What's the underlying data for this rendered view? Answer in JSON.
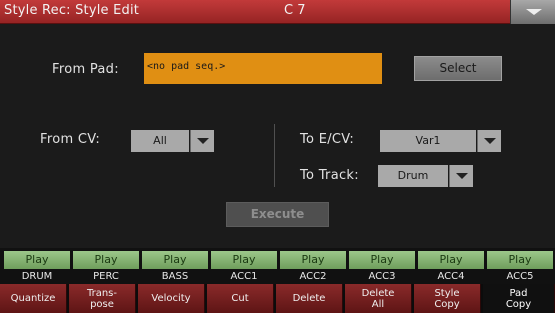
{
  "title": {
    "text": "Style Rec: Style Edit",
    "chord": "C 7",
    "menu_icon": "chevron-down-icon"
  },
  "from_pad": {
    "label": "From Pad:",
    "value": "<no pad seq.>",
    "select_label": "Select"
  },
  "from_cv": {
    "label": "From CV:",
    "value": "All"
  },
  "to_ecv": {
    "label": "To E/CV:",
    "value": "Var1"
  },
  "to_track": {
    "label": "To Track:",
    "value": "Drum"
  },
  "execute_label": "Execute",
  "tracks": [
    {
      "play": "Play",
      "name": "DRUM"
    },
    {
      "play": "Play",
      "name": "PERC"
    },
    {
      "play": "Play",
      "name": "BASS"
    },
    {
      "play": "Play",
      "name": "ACC1"
    },
    {
      "play": "Play",
      "name": "ACC2"
    },
    {
      "play": "Play",
      "name": "ACC3"
    },
    {
      "play": "Play",
      "name": "ACC4"
    },
    {
      "play": "Play",
      "name": "ACC5"
    }
  ],
  "tabs": [
    {
      "line1": "Quantize",
      "line2": ""
    },
    {
      "line1": "Trans-",
      "line2": "pose"
    },
    {
      "line1": "Velocity",
      "line2": ""
    },
    {
      "line1": "Cut",
      "line2": ""
    },
    {
      "line1": "Delete",
      "line2": ""
    },
    {
      "line1": "Delete",
      "line2": "All"
    },
    {
      "line1": "Style",
      "line2": "Copy"
    },
    {
      "line1": "Pad",
      "line2": "Copy"
    }
  ],
  "colors": {
    "title_bar": "#b02f2f",
    "pad_field": "#e08f13",
    "play": "#8ab878",
    "tab": "#7a2222"
  }
}
